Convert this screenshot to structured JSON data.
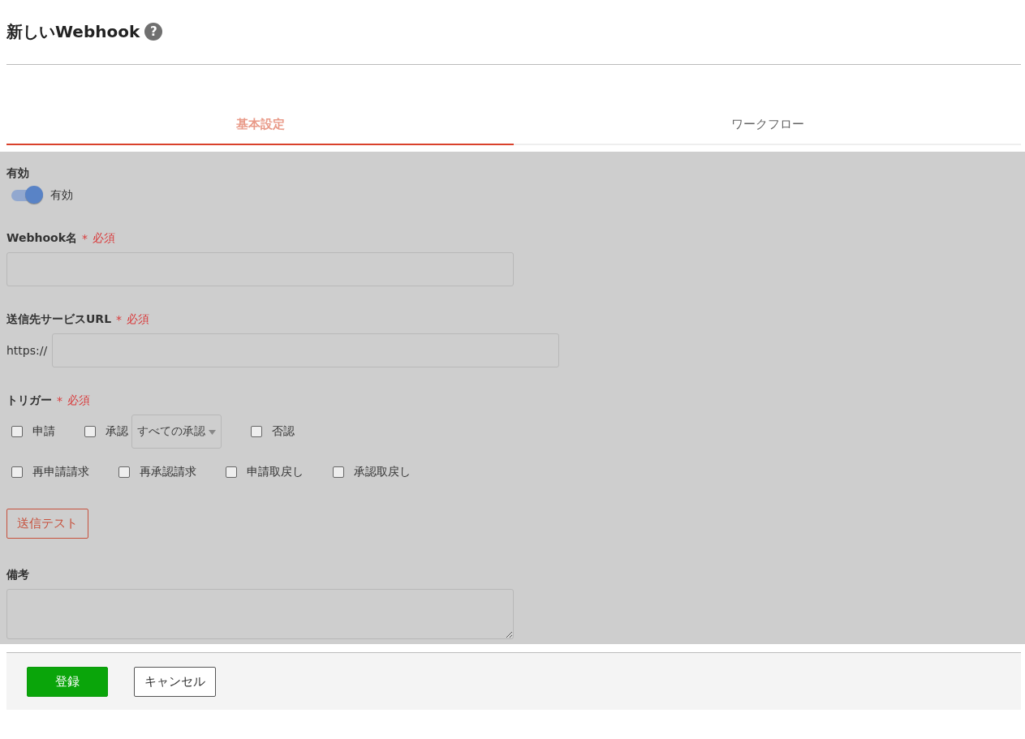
{
  "title": "新しいWebhook",
  "help_icon": "?",
  "tabs": [
    {
      "label": "基本設定",
      "selected": true
    },
    {
      "label": "ワークフロー",
      "selected": false
    }
  ],
  "enabled": {
    "label": "有効",
    "toggle_label": "有効",
    "on": true
  },
  "name_field": {
    "label": "Webhook名",
    "required_mark": "*",
    "required_text": "必須"
  },
  "url_field": {
    "label": "送信先サービスURL",
    "required_mark": "*",
    "required_text": "必須",
    "prefix": "https://"
  },
  "trigger": {
    "label": "トリガー",
    "required_mark": "*",
    "required_text": "必須",
    "rows": [
      [
        {
          "label": "申請",
          "checked": false
        },
        {
          "label": "承認",
          "checked": false,
          "select": "すべての承認"
        },
        {
          "label": "否認",
          "checked": false
        }
      ],
      [
        {
          "label": "再申請請求",
          "checked": false
        },
        {
          "label": "再承認請求",
          "checked": false
        },
        {
          "label": "申請取戻し",
          "checked": false
        },
        {
          "label": "承認取戻し",
          "checked": false
        }
      ]
    ]
  },
  "test_button": "送信テスト",
  "notes_field": {
    "label": "備考"
  },
  "footer": {
    "buttons": [
      {
        "label": "登録",
        "kind": "primary"
      },
      {
        "label": "キャンセル",
        "kind": "secondary"
      }
    ]
  }
}
